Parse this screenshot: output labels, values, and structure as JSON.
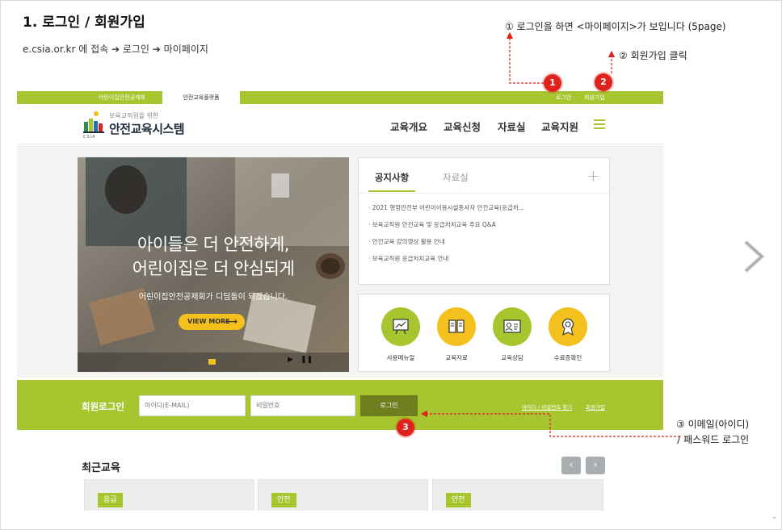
{
  "slide": {
    "title": "1. 로그인 / 회원가입",
    "url_path": "e.csia.or.kr 에 접속 ➔ 로그인 ➔ 마이페이지",
    "note_1": "①  로그인을 하면 <마이페이지>가 보입니다 (5page)",
    "note_2": "②  회원가입 클릭",
    "note_3_line1": "③ 이메일(아이디)",
    "note_3_line2": "/ 패스워드 로그인",
    "markers": [
      "1",
      "2",
      "3"
    ],
    "corner_mark": "-"
  },
  "site": {
    "top_tabs": [
      "어린이집안전공제회",
      "안전교육플랫폼"
    ],
    "top_links": {
      "login": "로그인",
      "join": "회원가입"
    },
    "logo": {
      "tagline": "보육교직원을 위한",
      "name": "안전교육시스템",
      "csia": "CSIA"
    },
    "nav": [
      "교육개요",
      "교육신청",
      "자료실",
      "교육지원"
    ],
    "hero": {
      "line1": "아이들은 더 안전하게,",
      "line2": "어린이집은 더 안심되게",
      "sub": "어린이집안전공제회가 디딤돌이 되겠습니다.",
      "button": "VIEW MORE",
      "button_arrow": "⟶",
      "play": "▶",
      "pause": "❚❚"
    },
    "notice": {
      "tab_active": "공지사항",
      "tab_other": "자료실",
      "plus": "+",
      "items": [
        "2021 행정안전부 어린이이용시설종사자 안전교육(응급처...",
        "보육교직원 안전교육 및 응급처치교육 주요 Q&A",
        "안전교육 강의영상 활용 안내",
        "보육교직원 응급처치교육 안내"
      ]
    },
    "quick_links": [
      "사용메뉴얼",
      "교육자료",
      "교육상담",
      "수료증확인"
    ],
    "login": {
      "title": "회원로그인",
      "id_placeholder": "아이디(E-MAIL)",
      "pw_placeholder": "비밀번호",
      "button": "로그인",
      "find_link": "아이디 / 비밀번호 찾기",
      "join_link": "회원가입"
    },
    "recent": {
      "title": "최근교육",
      "prev": "‹",
      "next": "›",
      "cards": [
        "응급",
        "안전",
        "안전"
      ]
    }
  },
  "colors": {
    "brand_green": "#a6c52e",
    "accent_yellow": "#f3c01d",
    "marker_red": "#e0221c"
  }
}
